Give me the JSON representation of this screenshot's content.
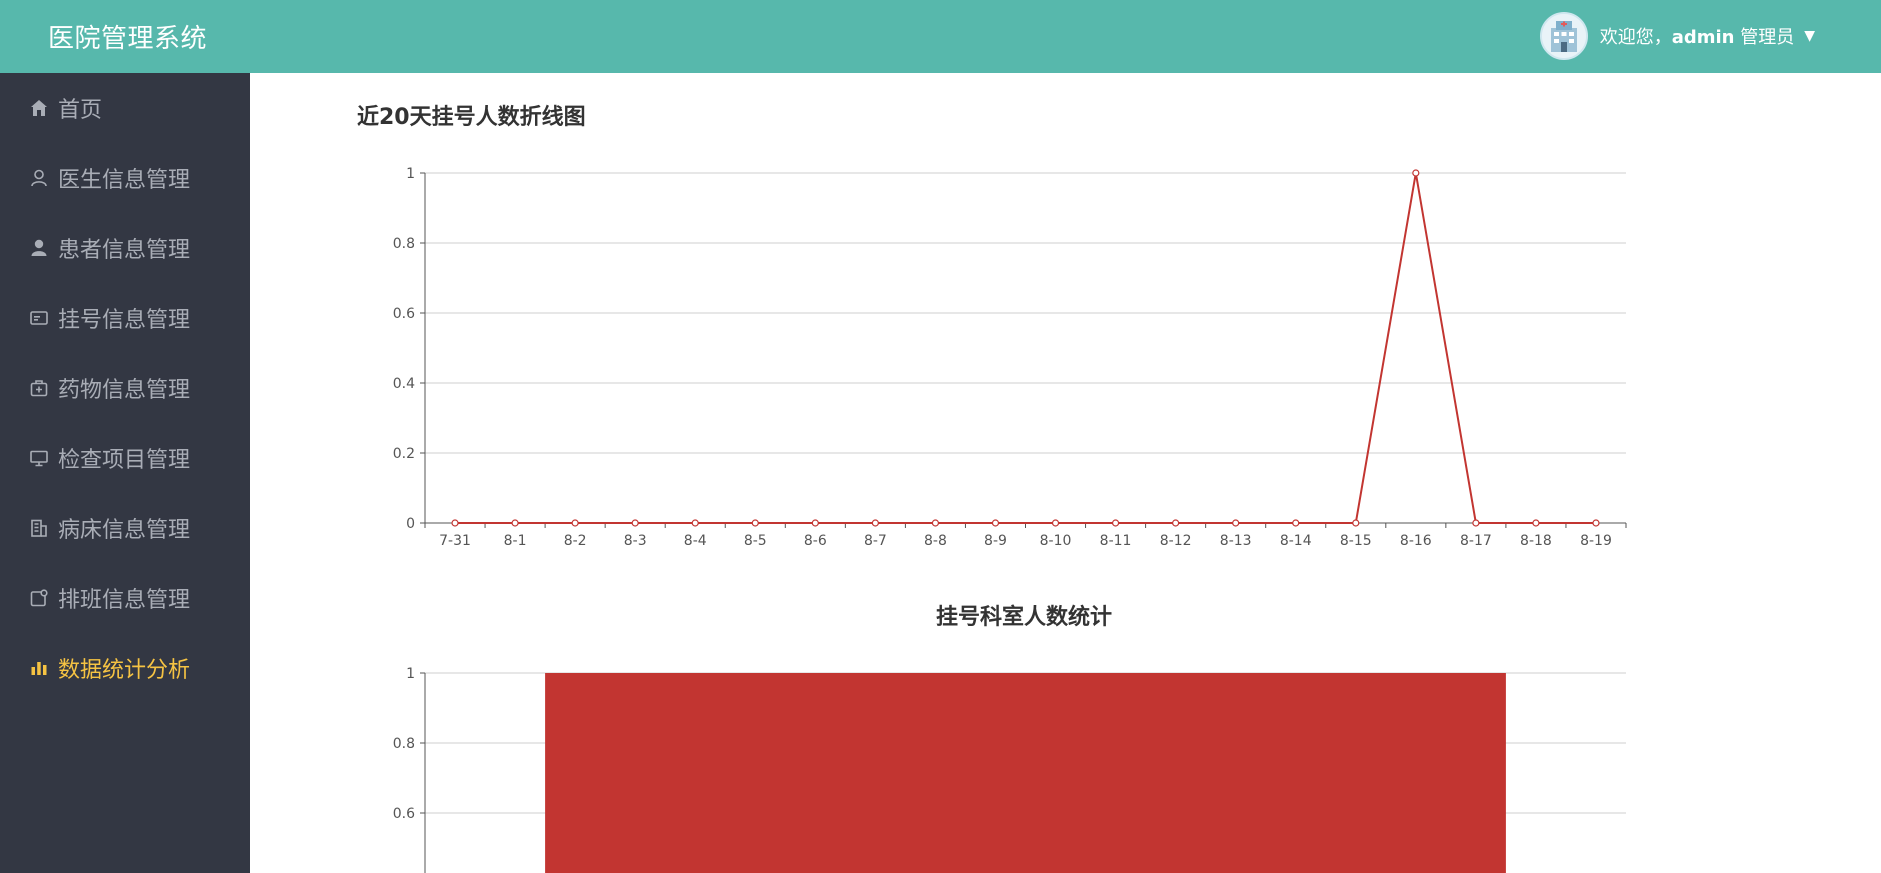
{
  "header": {
    "title": "医院管理系统",
    "welcome_prefix": "欢迎您，",
    "username": "admin",
    "role": "管理员",
    "bg_color": "#57b8ac"
  },
  "sidebar": {
    "bg_color": "#333743",
    "active_color": "#f6c343",
    "items": [
      {
        "label": "首页",
        "icon": "home-icon"
      },
      {
        "label": "医生信息管理",
        "icon": "user-outline-icon"
      },
      {
        "label": "患者信息管理",
        "icon": "user-solid-icon"
      },
      {
        "label": "挂号信息管理",
        "icon": "id-card-icon"
      },
      {
        "label": "药物信息管理",
        "icon": "medicine-box-icon"
      },
      {
        "label": "检查项目管理",
        "icon": "monitor-icon"
      },
      {
        "label": "病床信息管理",
        "icon": "building-icon"
      },
      {
        "label": "排班信息管理",
        "icon": "schedule-icon"
      },
      {
        "label": "数据统计分析",
        "icon": "bar-chart-icon",
        "active": true
      }
    ]
  },
  "chart_data": [
    {
      "type": "line",
      "title": "近20天挂号人数折线图",
      "categories": [
        "7-31",
        "8-1",
        "8-2",
        "8-3",
        "8-4",
        "8-5",
        "8-6",
        "8-7",
        "8-8",
        "8-9",
        "8-10",
        "8-11",
        "8-12",
        "8-13",
        "8-14",
        "8-15",
        "8-16",
        "8-17",
        "8-18",
        "8-19"
      ],
      "values": [
        0,
        0,
        0,
        0,
        0,
        0,
        0,
        0,
        0,
        0,
        0,
        0,
        0,
        0,
        0,
        0,
        1,
        0,
        0,
        0
      ],
      "ylim": [
        0,
        1
      ],
      "yticks": [
        "0",
        "0.2",
        "0.4",
        "0.6",
        "0.8",
        "1"
      ],
      "grid": true,
      "color": "#c23531"
    },
    {
      "type": "bar",
      "title": "挂号科室人数统计",
      "values": [
        1
      ],
      "ylim": [
        0,
        1
      ],
      "yticks_visible": [
        "0.6",
        "0.8",
        "1"
      ],
      "grid": true,
      "color": "#c23531"
    }
  ]
}
